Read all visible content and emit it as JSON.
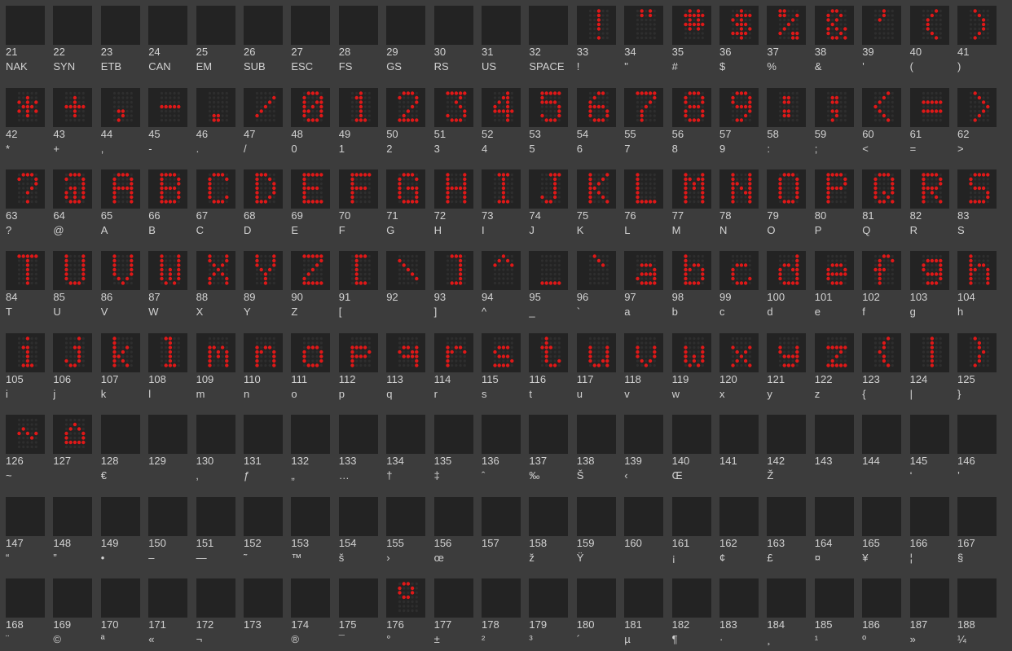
{
  "colors": {
    "background": "#3c3c3c",
    "cell": "#232323",
    "led_on": "#e01818",
    "led_off": "#2e2e2e",
    "text": "#d2d2d2"
  },
  "rows": [
    {
      "cells": [
        {
          "code": "21",
          "label": "NAK"
        },
        {
          "code": "22",
          "label": "SYN"
        },
        {
          "code": "23",
          "label": "ETB"
        },
        {
          "code": "24",
          "label": "CAN"
        },
        {
          "code": "25",
          "label": "EM"
        },
        {
          "code": "26",
          "label": "SUB"
        },
        {
          "code": "27",
          "label": "ESC"
        },
        {
          "code": "28",
          "label": "FS"
        },
        {
          "code": "29",
          "label": "GS"
        },
        {
          "code": "30",
          "label": "RS"
        },
        {
          "code": "31",
          "label": "US"
        },
        {
          "code": "32",
          "label": "SPACE"
        },
        {
          "code": "33",
          "label": "!"
        },
        {
          "code": "34",
          "label": "\""
        },
        {
          "code": "35",
          "label": "#"
        },
        {
          "code": "36",
          "label": "$"
        },
        {
          "code": "37",
          "label": "%"
        },
        {
          "code": "38",
          "label": "&"
        },
        {
          "code": "39",
          "label": "'"
        },
        {
          "code": "40",
          "label": "("
        },
        {
          "code": "41",
          "label": ")"
        }
      ]
    },
    {
      "cells": [
        {
          "code": "42",
          "label": "*"
        },
        {
          "code": "43",
          "label": "+"
        },
        {
          "code": "44",
          "label": ","
        },
        {
          "code": "45",
          "label": "-"
        },
        {
          "code": "46",
          "label": "."
        },
        {
          "code": "47",
          "label": "/"
        },
        {
          "code": "48",
          "label": "0"
        },
        {
          "code": "49",
          "label": "1"
        },
        {
          "code": "50",
          "label": "2"
        },
        {
          "code": "51",
          "label": "3"
        },
        {
          "code": "52",
          "label": "4"
        },
        {
          "code": "53",
          "label": "5"
        },
        {
          "code": "54",
          "label": "6"
        },
        {
          "code": "55",
          "label": "7"
        },
        {
          "code": "56",
          "label": "8"
        },
        {
          "code": "57",
          "label": "9"
        },
        {
          "code": "58",
          "label": ":"
        },
        {
          "code": "59",
          "label": ";"
        },
        {
          "code": "60",
          "label": "<"
        },
        {
          "code": "61",
          "label": "="
        },
        {
          "code": "62",
          "label": ">"
        }
      ]
    },
    {
      "cells": [
        {
          "code": "63",
          "label": "?"
        },
        {
          "code": "64",
          "label": "@"
        },
        {
          "code": "65",
          "label": "A"
        },
        {
          "code": "66",
          "label": "B"
        },
        {
          "code": "67",
          "label": "C"
        },
        {
          "code": "68",
          "label": "D"
        },
        {
          "code": "69",
          "label": "E"
        },
        {
          "code": "70",
          "label": "F"
        },
        {
          "code": "71",
          "label": "G"
        },
        {
          "code": "72",
          "label": "H"
        },
        {
          "code": "73",
          "label": "I"
        },
        {
          "code": "74",
          "label": "J"
        },
        {
          "code": "75",
          "label": "K"
        },
        {
          "code": "76",
          "label": "L"
        },
        {
          "code": "77",
          "label": "M"
        },
        {
          "code": "78",
          "label": "N"
        },
        {
          "code": "79",
          "label": "O"
        },
        {
          "code": "80",
          "label": "P"
        },
        {
          "code": "81",
          "label": "Q"
        },
        {
          "code": "82",
          "label": "R"
        },
        {
          "code": "83",
          "label": "S"
        }
      ]
    },
    {
      "cells": [
        {
          "code": "84",
          "label": "T"
        },
        {
          "code": "85",
          "label": "U"
        },
        {
          "code": "86",
          "label": "V"
        },
        {
          "code": "87",
          "label": "W"
        },
        {
          "code": "88",
          "label": "X"
        },
        {
          "code": "89",
          "label": "Y"
        },
        {
          "code": "90",
          "label": "Z"
        },
        {
          "code": "91",
          "label": "["
        },
        {
          "code": "92",
          "label": ""
        },
        {
          "code": "93",
          "label": "]"
        },
        {
          "code": "94",
          "label": "^"
        },
        {
          "code": "95",
          "label": "_"
        },
        {
          "code": "96",
          "label": "`"
        },
        {
          "code": "97",
          "label": "a"
        },
        {
          "code": "98",
          "label": "b"
        },
        {
          "code": "99",
          "label": "c"
        },
        {
          "code": "100",
          "label": "d"
        },
        {
          "code": "101",
          "label": "e"
        },
        {
          "code": "102",
          "label": "f"
        },
        {
          "code": "103",
          "label": "g"
        },
        {
          "code": "104",
          "label": "h"
        }
      ]
    },
    {
      "cells": [
        {
          "code": "105",
          "label": "i"
        },
        {
          "code": "106",
          "label": "j"
        },
        {
          "code": "107",
          "label": "k"
        },
        {
          "code": "108",
          "label": "l"
        },
        {
          "code": "109",
          "label": "m"
        },
        {
          "code": "110",
          "label": "n"
        },
        {
          "code": "111",
          "label": "o"
        },
        {
          "code": "112",
          "label": "p"
        },
        {
          "code": "113",
          "label": "q"
        },
        {
          "code": "114",
          "label": "r"
        },
        {
          "code": "115",
          "label": "s"
        },
        {
          "code": "116",
          "label": "t"
        },
        {
          "code": "117",
          "label": "u"
        },
        {
          "code": "118",
          "label": "v"
        },
        {
          "code": "119",
          "label": "w"
        },
        {
          "code": "120",
          "label": "x"
        },
        {
          "code": "121",
          "label": "y"
        },
        {
          "code": "122",
          "label": "z"
        },
        {
          "code": "123",
          "label": "{"
        },
        {
          "code": "124",
          "label": "|"
        },
        {
          "code": "125",
          "label": "}"
        }
      ]
    },
    {
      "cells": [
        {
          "code": "126",
          "label": "~"
        },
        {
          "code": "127",
          "label": ""
        },
        {
          "code": "128",
          "label": "€"
        },
        {
          "code": "129",
          "label": ""
        },
        {
          "code": "130",
          "label": "‚"
        },
        {
          "code": "131",
          "label": "ƒ"
        },
        {
          "code": "132",
          "label": "„"
        },
        {
          "code": "133",
          "label": "…"
        },
        {
          "code": "134",
          "label": "†"
        },
        {
          "code": "135",
          "label": "‡"
        },
        {
          "code": "136",
          "label": "ˆ"
        },
        {
          "code": "137",
          "label": "‰"
        },
        {
          "code": "138",
          "label": "Š"
        },
        {
          "code": "139",
          "label": "‹"
        },
        {
          "code": "140",
          "label": "Œ"
        },
        {
          "code": "141",
          "label": ""
        },
        {
          "code": "142",
          "label": "Ž"
        },
        {
          "code": "143",
          "label": ""
        },
        {
          "code": "144",
          "label": ""
        },
        {
          "code": "145",
          "label": "‘"
        },
        {
          "code": "146",
          "label": "’"
        }
      ]
    },
    {
      "cells": [
        {
          "code": "147",
          "label": "“"
        },
        {
          "code": "148",
          "label": "”"
        },
        {
          "code": "149",
          "label": "•"
        },
        {
          "code": "150",
          "label": "–"
        },
        {
          "code": "151",
          "label": "—"
        },
        {
          "code": "152",
          "label": "˜"
        },
        {
          "code": "153",
          "label": "™"
        },
        {
          "code": "154",
          "label": "š"
        },
        {
          "code": "155",
          "label": "›"
        },
        {
          "code": "156",
          "label": "œ"
        },
        {
          "code": "157",
          "label": ""
        },
        {
          "code": "158",
          "label": "ž"
        },
        {
          "code": "159",
          "label": "Ÿ"
        },
        {
          "code": "160",
          "label": ""
        },
        {
          "code": "161",
          "label": "¡"
        },
        {
          "code": "162",
          "label": "¢"
        },
        {
          "code": "163",
          "label": "£"
        },
        {
          "code": "164",
          "label": "¤"
        },
        {
          "code": "165",
          "label": "¥"
        },
        {
          "code": "166",
          "label": "¦"
        },
        {
          "code": "167",
          "label": "§"
        }
      ]
    },
    {
      "cells": [
        {
          "code": "168",
          "label": "¨"
        },
        {
          "code": "169",
          "label": "©"
        },
        {
          "code": "170",
          "label": "ª"
        },
        {
          "code": "171",
          "label": "«"
        },
        {
          "code": "172",
          "label": "¬"
        },
        {
          "code": "173",
          "label": ""
        },
        {
          "code": "174",
          "label": "®"
        },
        {
          "code": "175",
          "label": "¯"
        },
        {
          "code": "176",
          "label": "°"
        },
        {
          "code": "177",
          "label": "±"
        },
        {
          "code": "178",
          "label": "²"
        },
        {
          "code": "179",
          "label": "³"
        },
        {
          "code": "180",
          "label": "´"
        },
        {
          "code": "181",
          "label": "µ"
        },
        {
          "code": "182",
          "label": "¶"
        },
        {
          "code": "183",
          "label": "·"
        },
        {
          "code": "184",
          "label": "¸"
        },
        {
          "code": "185",
          "label": "¹"
        },
        {
          "code": "186",
          "label": "º"
        },
        {
          "code": "187",
          "label": "»"
        },
        {
          "code": "188",
          "label": "¼"
        }
      ]
    }
  ]
}
